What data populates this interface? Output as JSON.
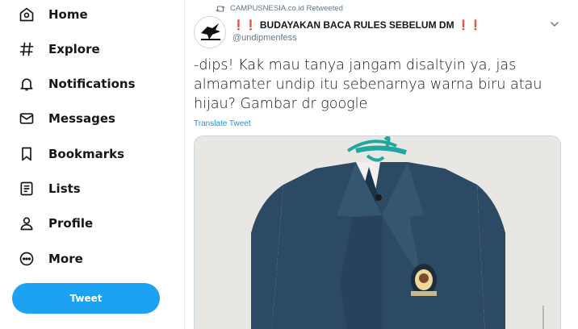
{
  "sidebar": {
    "items": [
      {
        "label": "Home",
        "icon": "home-icon"
      },
      {
        "label": "Explore",
        "icon": "hashtag-icon"
      },
      {
        "label": "Notifications",
        "icon": "bell-icon"
      },
      {
        "label": "Messages",
        "icon": "envelope-icon"
      },
      {
        "label": "Bookmarks",
        "icon": "bookmark-icon"
      },
      {
        "label": "Lists",
        "icon": "list-icon"
      },
      {
        "label": "Profile",
        "icon": "person-icon"
      },
      {
        "label": "More",
        "icon": "more-circle-icon"
      }
    ],
    "tweet_button": "Tweet"
  },
  "tweet": {
    "retweeted_by": "CAMPUSNESIA.co.id Retweeted",
    "author_name": "BUDAYAKAN BACA RULES SEBELUM DM",
    "author_handle": "@undipmenfess",
    "text": "-dips! Kak mau tanya jangam disaltyin ya, jas almamater undip itu sebenarnya warna biru atau hijau? Gambar dr google",
    "translate_label": "Translate Tweet"
  },
  "colors": {
    "accent": "#1da1f2",
    "link": "#1b95e0",
    "muted": "#657786",
    "jacket": "#2c4a63",
    "emoji_red": "#e0245e"
  }
}
